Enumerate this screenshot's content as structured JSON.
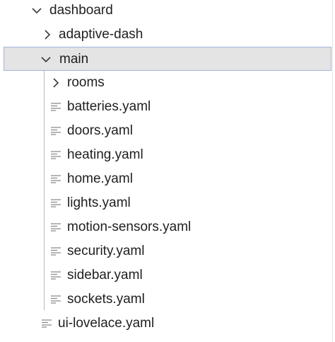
{
  "explorer": {
    "items": [
      {
        "label": "dashboard",
        "kind": "folder",
        "expanded": true,
        "icon": "chevron-down-icon"
      },
      {
        "label": "adaptive-dash",
        "kind": "folder",
        "expanded": false,
        "icon": "chevron-right-icon"
      },
      {
        "label": "main",
        "kind": "folder",
        "expanded": true,
        "selected": true,
        "icon": "chevron-down-icon"
      },
      {
        "label": "rooms",
        "kind": "folder",
        "expanded": false,
        "icon": "chevron-right-icon"
      },
      {
        "label": "batteries.yaml",
        "kind": "file",
        "icon": "file-lines-icon"
      },
      {
        "label": "doors.yaml",
        "kind": "file",
        "icon": "file-lines-icon"
      },
      {
        "label": "heating.yaml",
        "kind": "file",
        "icon": "file-lines-icon"
      },
      {
        "label": "home.yaml",
        "kind": "file",
        "icon": "file-lines-icon"
      },
      {
        "label": "lights.yaml",
        "kind": "file",
        "icon": "file-lines-icon"
      },
      {
        "label": "motion-sensors.yaml",
        "kind": "file",
        "icon": "file-lines-icon"
      },
      {
        "label": "security.yaml",
        "kind": "file",
        "icon": "file-lines-icon"
      },
      {
        "label": "sidebar.yaml",
        "kind": "file",
        "icon": "file-lines-icon"
      },
      {
        "label": "sockets.yaml",
        "kind": "file",
        "icon": "file-lines-icon"
      },
      {
        "label": "ui-lovelace.yaml",
        "kind": "file",
        "icon": "file-lines-icon"
      }
    ]
  },
  "colors": {
    "selection_background": "#e4e4e4",
    "selection_border": "#9fb7db",
    "text": "#1f1f1f",
    "icon": "#8a8a8a",
    "indent_guide": "#b9b9b9"
  }
}
